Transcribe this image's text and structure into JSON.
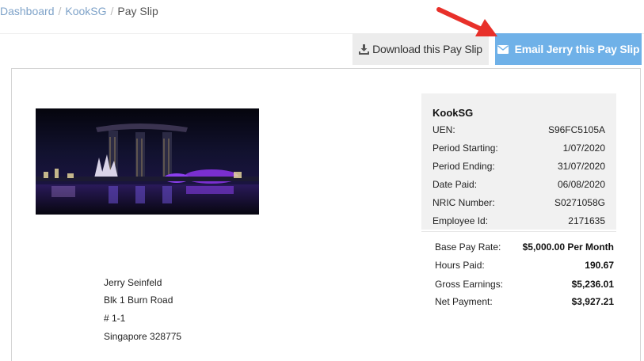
{
  "breadcrumb": {
    "items": [
      "Dashboard",
      "KookSG"
    ],
    "current": "Pay Slip",
    "separator": "/"
  },
  "toolbar": {
    "download_label": "Download this Pay Slip",
    "email_label": "Email Jerry this Pay Slip"
  },
  "colors": {
    "email_button": "#6fb1e8",
    "download_button": "#ececec",
    "arrow": "#e8302a",
    "link": "#7fa3c9"
  },
  "company": {
    "name": "KookSG",
    "rows": [
      {
        "label": "UEN:",
        "value": "S96FC5105A"
      },
      {
        "label": "Period Starting:",
        "value": "1/07/2020"
      },
      {
        "label": "Period Ending:",
        "value": "31/07/2020"
      },
      {
        "label": "Date Paid:",
        "value": "06/08/2020"
      },
      {
        "label": "NRIC Number:",
        "value": "S0271058G"
      },
      {
        "label": "Employee Id:",
        "value": "2171635"
      }
    ]
  },
  "pay": {
    "rows": [
      {
        "label": "Base Pay Rate:",
        "value": "$5,000.00 Per Month"
      },
      {
        "label": "Hours Paid:",
        "value": "190.67"
      },
      {
        "label": "Gross Earnings:",
        "value": "$5,236.01"
      },
      {
        "label": "Net Payment:",
        "value": "$3,927.21"
      }
    ]
  },
  "employee": {
    "lines": [
      "Jerry Seinfeld",
      "Blk 1 Burn Road",
      "# 1-1",
      "Singapore 328775"
    ]
  }
}
